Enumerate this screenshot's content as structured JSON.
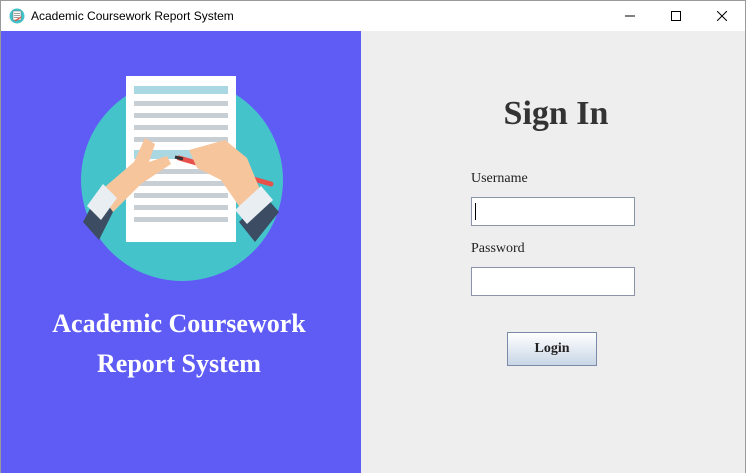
{
  "window": {
    "title": "Academic Coursework Report System",
    "icon": "app-notebook-icon"
  },
  "left_panel": {
    "background": "#5f5cf6",
    "illustration": "document-writing-illustration",
    "brand_line1": "Academic Coursework",
    "brand_line2": "Report System"
  },
  "signin": {
    "heading": "Sign In",
    "username_label": "Username",
    "username_value": "",
    "password_label": "Password",
    "password_value": "",
    "login_label": "Login"
  },
  "colors": {
    "accent": "#5f5cf6",
    "panel_bg": "#eeeeee",
    "circle": "#45c3cb"
  }
}
